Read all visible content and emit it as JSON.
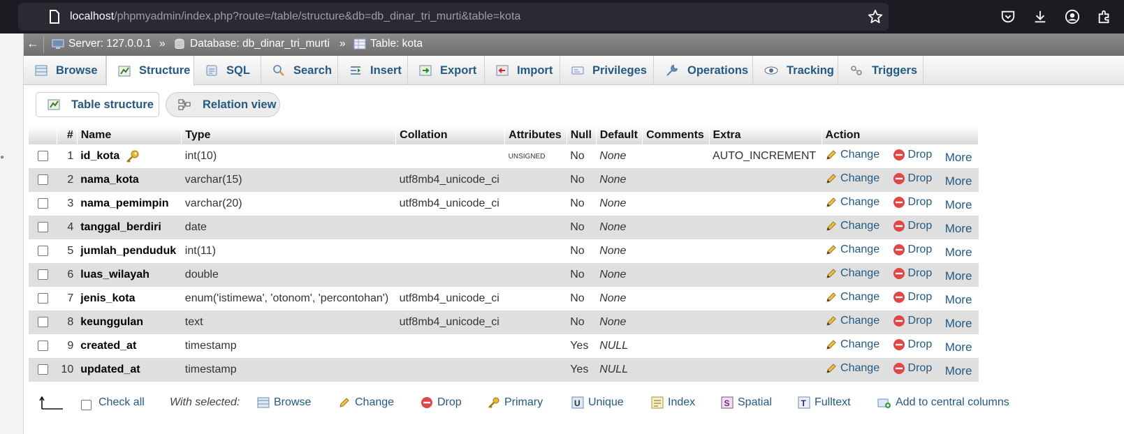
{
  "browser": {
    "url_host": "localhost",
    "url_rest": "/phpmyadmin/index.php?route=/table/structure&db=db_dinar_tri_murti&table=kota"
  },
  "breadcrumb": {
    "server": "Server: 127.0.0.1",
    "database": "Database: db_dinar_tri_murti",
    "table": "Table: kota",
    "separator": "»"
  },
  "tabs": [
    {
      "label": "Browse"
    },
    {
      "label": "Structure"
    },
    {
      "label": "SQL"
    },
    {
      "label": "Search"
    },
    {
      "label": "Insert"
    },
    {
      "label": "Export"
    },
    {
      "label": "Import"
    },
    {
      "label": "Privileges"
    },
    {
      "label": "Operations"
    },
    {
      "label": "Tracking"
    },
    {
      "label": "Triggers"
    }
  ],
  "subtabs": {
    "table_structure": "Table structure",
    "relation_view": "Relation view"
  },
  "table": {
    "headers": [
      "#",
      "Name",
      "Type",
      "Collation",
      "Attributes",
      "Null",
      "Default",
      "Comments",
      "Extra",
      "Action"
    ],
    "action_change": "Change",
    "action_drop": "Drop",
    "action_more": "More",
    "rows": [
      {
        "num": "1",
        "name": "id_kota",
        "type": "int(10)",
        "collation": "",
        "attributes": "UNSIGNED",
        "null": "No",
        "default": "None",
        "comments": "",
        "extra": "AUTO_INCREMENT"
      },
      {
        "num": "2",
        "name": "nama_kota",
        "type": "varchar(15)",
        "collation": "utf8mb4_unicode_ci",
        "attributes": "",
        "null": "No",
        "default": "None",
        "comments": "",
        "extra": ""
      },
      {
        "num": "3",
        "name": "nama_pemimpin",
        "type": "varchar(20)",
        "collation": "utf8mb4_unicode_ci",
        "attributes": "",
        "null": "No",
        "default": "None",
        "comments": "",
        "extra": ""
      },
      {
        "num": "4",
        "name": "tanggal_berdiri",
        "type": "date",
        "collation": "",
        "attributes": "",
        "null": "No",
        "default": "None",
        "comments": "",
        "extra": ""
      },
      {
        "num": "5",
        "name": "jumlah_penduduk",
        "type": "int(11)",
        "collation": "",
        "attributes": "",
        "null": "No",
        "default": "None",
        "comments": "",
        "extra": ""
      },
      {
        "num": "6",
        "name": "luas_wilayah",
        "type": "double",
        "collation": "",
        "attributes": "",
        "null": "No",
        "default": "None",
        "comments": "",
        "extra": ""
      },
      {
        "num": "7",
        "name": "jenis_kota",
        "type": "enum('istimewa', 'otonom', 'percontohan')",
        "collation": "utf8mb4_unicode_ci",
        "attributes": "",
        "null": "No",
        "default": "None",
        "comments": "",
        "extra": ""
      },
      {
        "num": "8",
        "name": "keunggulan",
        "type": "text",
        "collation": "utf8mb4_unicode_ci",
        "attributes": "",
        "null": "No",
        "default": "None",
        "comments": "",
        "extra": ""
      },
      {
        "num": "9",
        "name": "created_at",
        "type": "timestamp",
        "collation": "",
        "attributes": "",
        "null": "Yes",
        "default": "NULL",
        "comments": "",
        "extra": ""
      },
      {
        "num": "10",
        "name": "updated_at",
        "type": "timestamp",
        "collation": "",
        "attributes": "",
        "null": "Yes",
        "default": "NULL",
        "comments": "",
        "extra": ""
      }
    ]
  },
  "footer": {
    "check_all": "Check all",
    "with_selected": "With selected:",
    "browse": "Browse",
    "change": "Change",
    "drop": "Drop",
    "primary": "Primary",
    "unique": "Unique",
    "index": "Index",
    "spatial": "Spatial",
    "fulltext": "Fulltext",
    "add_central": "Add to central columns"
  },
  "colors": {
    "link": "#235a81",
    "breadcrumb_bg": "#7d7d7d",
    "row_even": "#dfdfdf",
    "browser_bg": "#1c1b22"
  }
}
